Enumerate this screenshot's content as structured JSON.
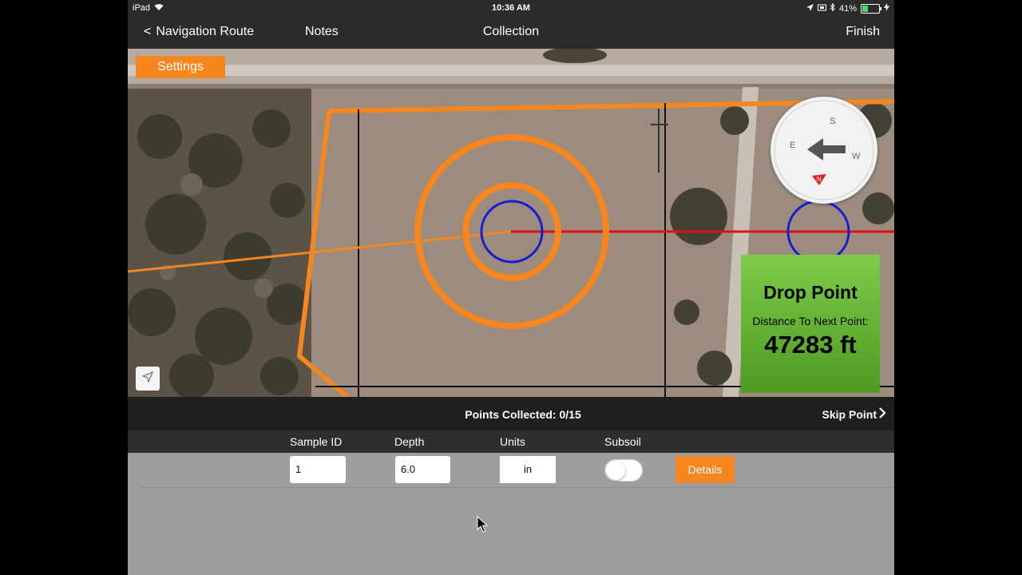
{
  "status_bar": {
    "device": "iPad",
    "time": "10:36 AM",
    "battery": "41%",
    "battery_level": 0.41,
    "icons": [
      "wifi-icon",
      "location-icon",
      "screen-rotation-icon",
      "bluetooth-icon",
      "battery-icon",
      "charging-icon"
    ]
  },
  "nav": {
    "back_label": "Navigation Route",
    "notes_label": "Notes",
    "title": "Collection",
    "finish_label": "Finish"
  },
  "map": {
    "settings_label": "Settings",
    "compass": {
      "directions": [
        "S",
        "W",
        "N",
        "E"
      ],
      "arrow_direction": "left"
    },
    "drop_point": {
      "title": "Drop Point",
      "distance_label": "Distance To Next Point:",
      "distance_value": "47283 ft"
    },
    "colors": {
      "boundary": "#f6861f",
      "target_ring": "#1a1ad6",
      "route_line": "#e01010",
      "panel": "#6dbb3a"
    }
  },
  "points_bar": {
    "points_collected": "Points Collected: 0/15",
    "skip_label": "Skip Point"
  },
  "form": {
    "headers": {
      "sample_id": "Sample ID",
      "depth": "Depth",
      "units": "Units",
      "subsoil": "Subsoil"
    },
    "values": {
      "sample_id": "1",
      "depth": "6.0",
      "units": "in",
      "subsoil_on": false
    },
    "details_label": "Details"
  },
  "accent_color": "#f6861f"
}
